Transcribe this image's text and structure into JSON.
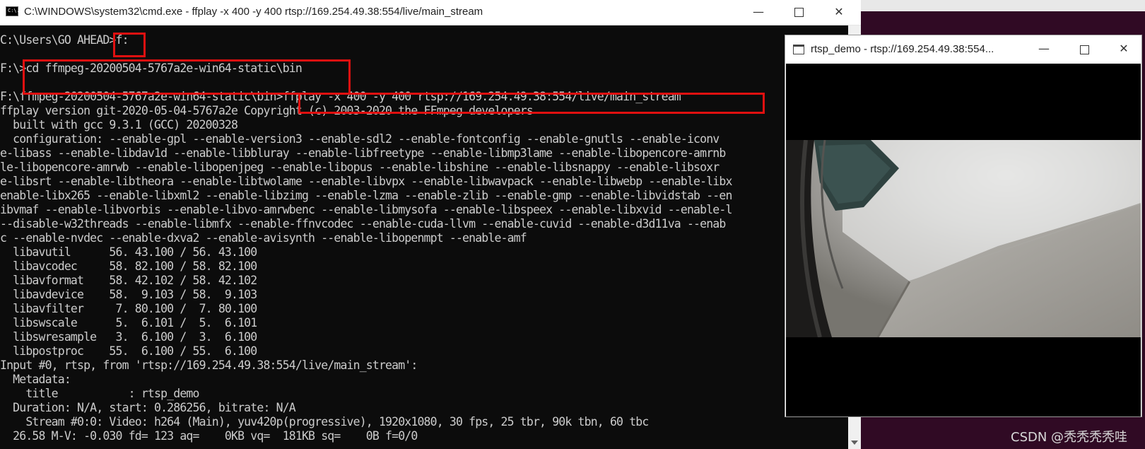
{
  "cmd_window": {
    "title": "C:\\WINDOWS\\system32\\cmd.exe - ffplay  -x 400 -y 400 rtsp://169.254.49.38:554/live/main_stream",
    "icon_text": "C:\\."
  },
  "console_lines": [
    "",
    "C:\\Users\\GO AHEAD>f:",
    "",
    "F:\\>cd ffmpeg-20200504-5767a2e-win64-static\\bin",
    "",
    "F:\\ffmpeg-20200504-5767a2e-win64-static\\bin>ffplay -x 400 -y 400 rtsp://169.254.49.38:554/live/main_stream",
    "ffplay version git-2020-05-04-5767a2e Copyright (c) 2003-2020 the FFmpeg developers",
    "  built with gcc 9.3.1 (GCC) 20200328",
    "  configuration: --enable-gpl --enable-version3 --enable-sdl2 --enable-fontconfig --enable-gnutls --enable-iconv",
    "e-libass --enable-libdav1d --enable-libbluray --enable-libfreetype --enable-libmp3lame --enable-libopencore-amrnb",
    "le-libopencore-amrwb --enable-libopenjpeg --enable-libopus --enable-libshine --enable-libsnappy --enable-libsoxr",
    "e-libsrt --enable-libtheora --enable-libtwolame --enable-libvpx --enable-libwavpack --enable-libwebp --enable-libx",
    "enable-libx265 --enable-libxml2 --enable-libzimg --enable-lzma --enable-zlib --enable-gmp --enable-libvidstab --en",
    "ibvmaf --enable-libvorbis --enable-libvo-amrwbenc --enable-libmysofa --enable-libspeex --enable-libxvid --enable-l",
    "--disable-w32threads --enable-libmfx --enable-ffnvcodec --enable-cuda-llvm --enable-cuvid --enable-d3d11va --enab",
    "c --enable-nvdec --enable-dxva2 --enable-avisynth --enable-libopenmpt --enable-amf",
    "  libavutil      56. 43.100 / 56. 43.100",
    "  libavcodec     58. 82.100 / 58. 82.100",
    "  libavformat    58. 42.102 / 58. 42.102",
    "  libavdevice    58.  9.103 / 58.  9.103",
    "  libavfilter     7. 80.100 /  7. 80.100",
    "  libswscale      5.  6.101 /  5.  6.101",
    "  libswresample   3.  6.100 /  3.  6.100",
    "  libpostproc    55.  6.100 / 55.  6.100",
    "Input #0, rtsp, from 'rtsp://169.254.49.38:554/live/main_stream':",
    "  Metadata:",
    "    title           : rtsp_demo",
    "  Duration: N/A, start: 0.286256, bitrate: N/A",
    "    Stream #0:0: Video: h264 (Main), yuv420p(progressive), 1920x1080, 30 fps, 25 tbr, 90k tbn, 60 tbc",
    "  26.58 M-V: -0.030 fd= 123 aq=    0KB vq=  181KB sq=    0B f=0/0"
  ],
  "ffplay_window": {
    "title": "rtsp_demo - rtsp://169.254.49.38:554..."
  },
  "watermark": "CSDN @秃秃秃秃哇",
  "colors": {
    "console_bg": "#0c0c0c",
    "console_text": "#cccccc",
    "highlight_box": "#e01010",
    "desktop": "#300a24"
  }
}
